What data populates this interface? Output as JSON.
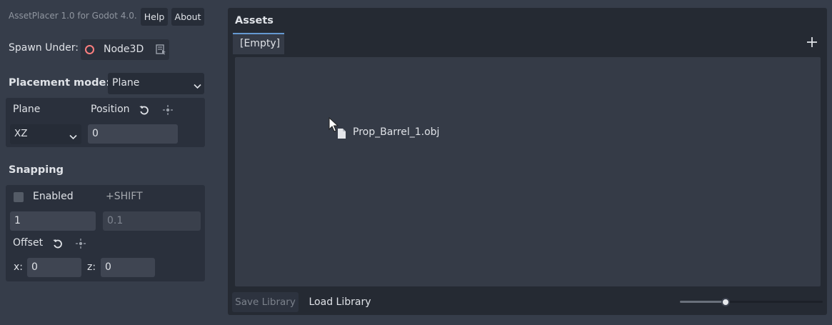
{
  "header": {
    "version_text": "AssetPlacer 1.0 for Godot 4.0.",
    "help_label": "Help",
    "about_label": "About"
  },
  "spawn": {
    "label": "Spawn Under:",
    "node_name": "Node3D",
    "node_icon_color": "#fc7f7f"
  },
  "placement": {
    "label": "Placement mode:",
    "mode_value": "Plane"
  },
  "plane": {
    "plane_label": "Plane",
    "position_label": "Position",
    "plane_value": "XZ",
    "position_value": "0"
  },
  "snapping": {
    "label": "Snapping",
    "enabled_label": "Enabled",
    "enabled_checked": false,
    "shift_label": "+SHIFT",
    "step_value": "1",
    "shift_placeholder": "0.1",
    "offset_label": "Offset",
    "x_label": "x:",
    "x_value": "0",
    "z_label": "z:",
    "z_value": "0"
  },
  "assets": {
    "title": "Assets",
    "tabs": [
      {
        "label": "[Empty]",
        "active": true
      }
    ],
    "items": [
      {
        "name": "Prop_Barrel_1.obj",
        "icon": "file-icon"
      }
    ]
  },
  "library": {
    "save_label": "Save Library",
    "save_disabled": true,
    "load_label": "Load Library"
  },
  "zoom": {
    "value_fraction": 0.32
  },
  "colors": {
    "accent": "#6599d1",
    "panel_bg": "#363d4a",
    "dark_bg": "#252a33"
  }
}
